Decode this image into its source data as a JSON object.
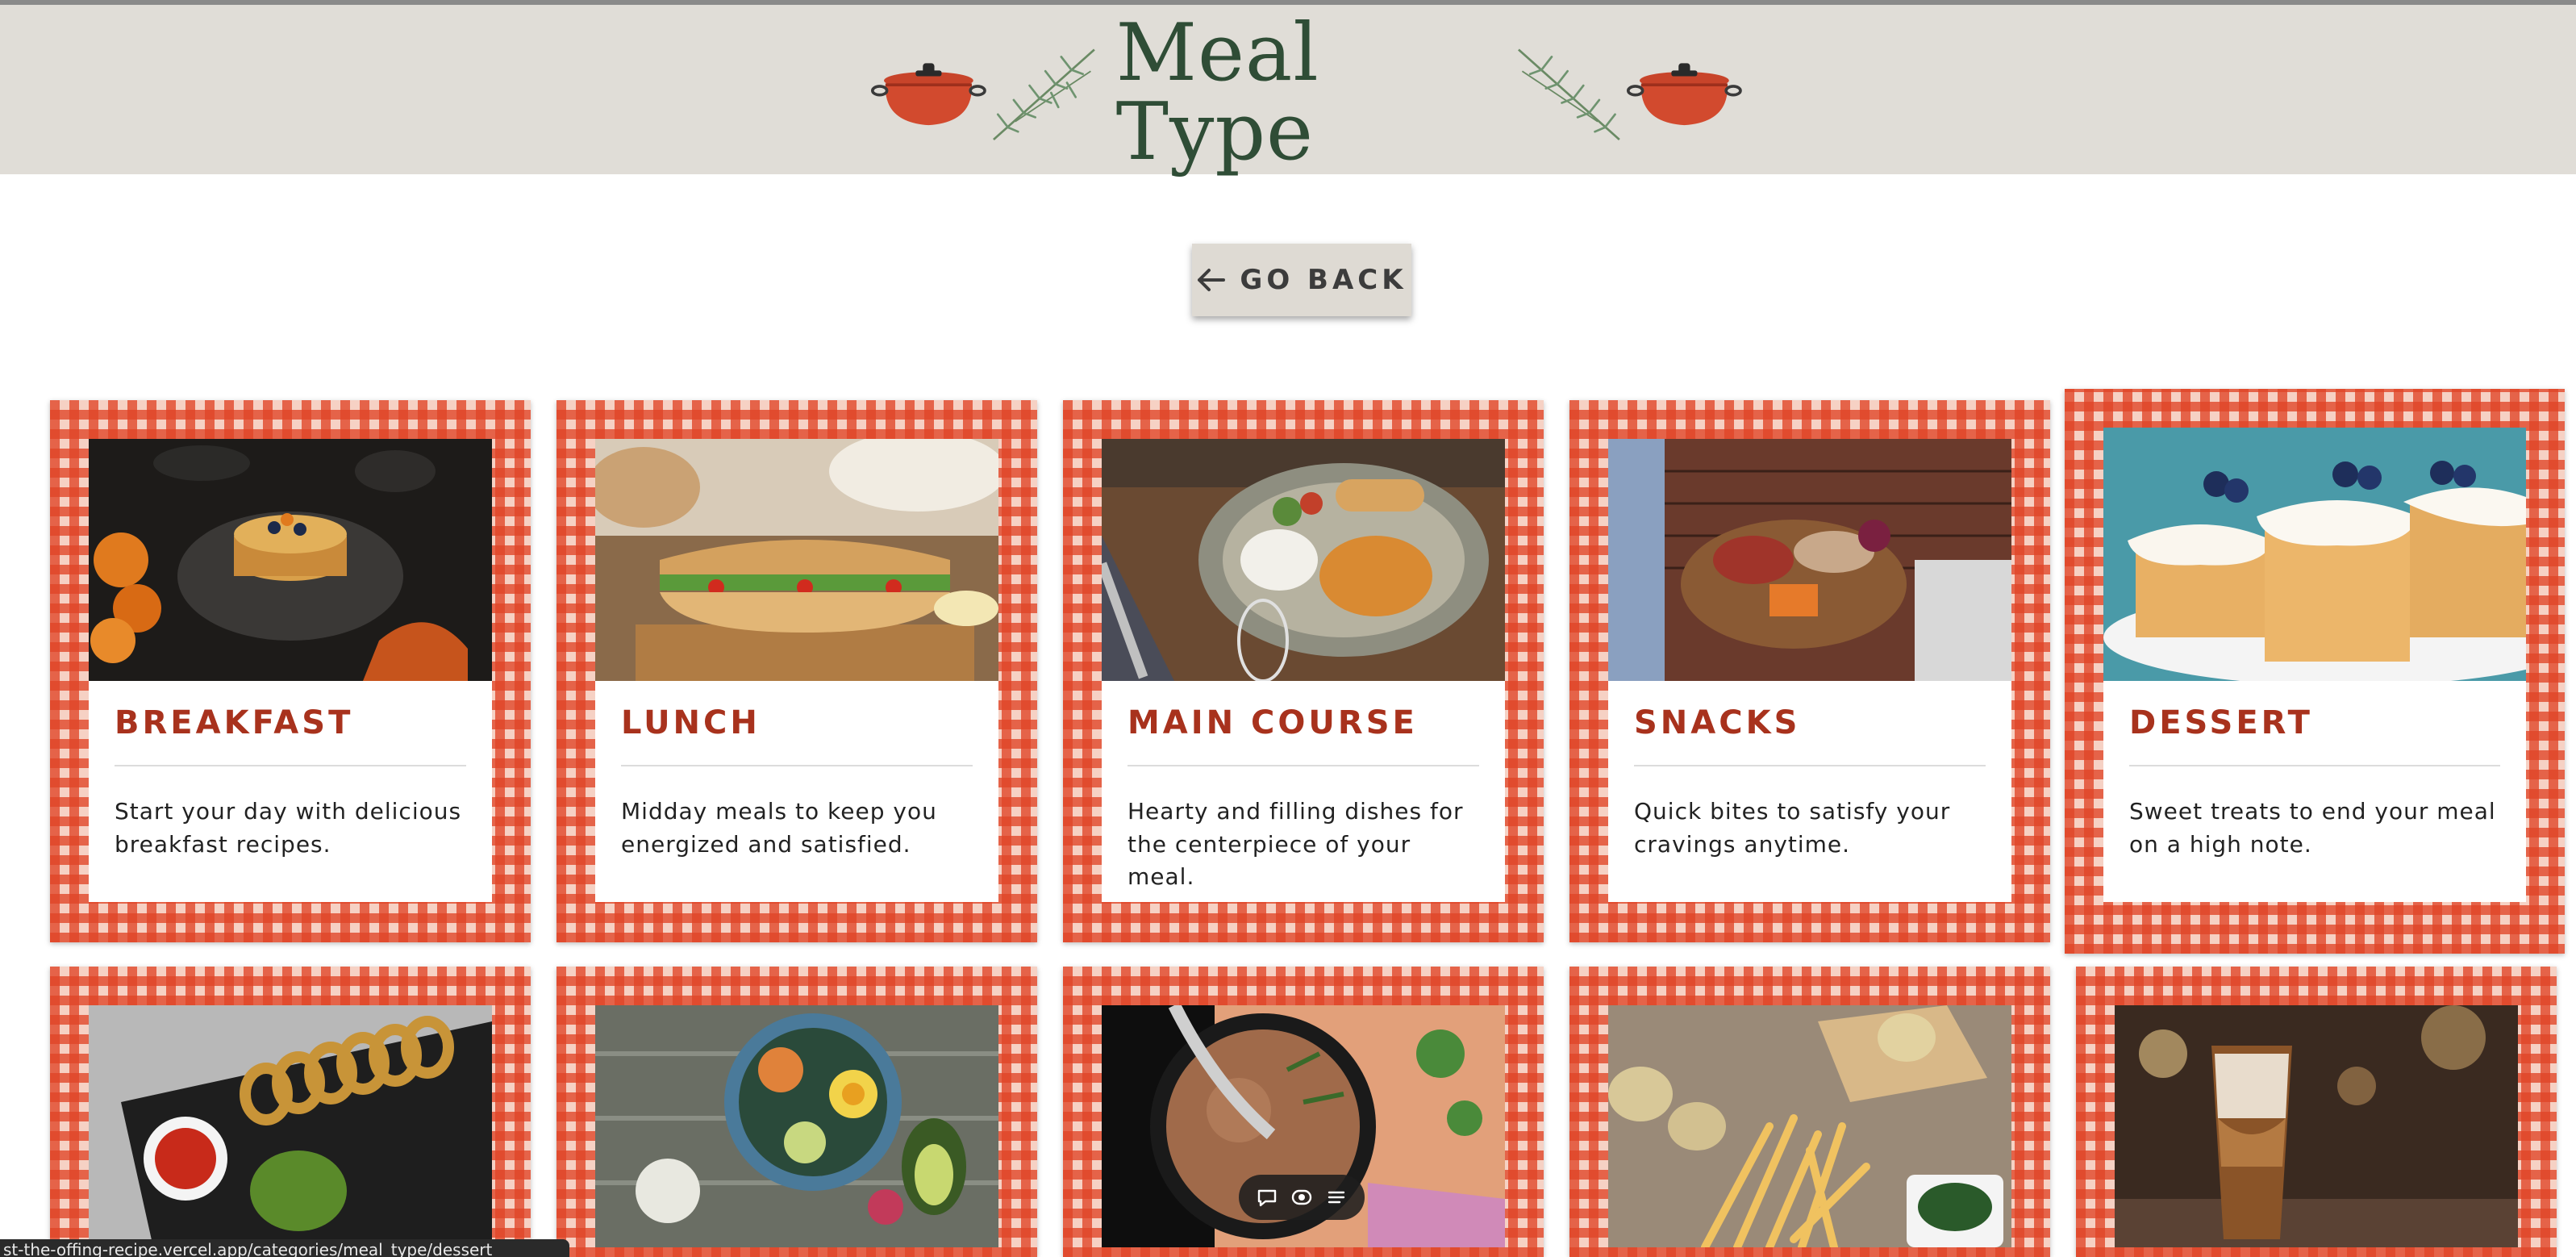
{
  "header": {
    "title": "Meal Type"
  },
  "actions": {
    "go_back_label": "GO BACK"
  },
  "cards": [
    {
      "title": "BREAKFAST",
      "description": "Start your day with delicious breakfast recipes.",
      "image": "pancakes-photo"
    },
    {
      "title": "LUNCH",
      "description": "Midday meals to keep you energized and satisfied.",
      "image": "sandwich-photo"
    },
    {
      "title": "MAIN COURSE",
      "description": "Hearty and filling dishes for the centerpiece of your meal.",
      "image": "plated-meal-photo"
    },
    {
      "title": "SNACKS",
      "description": "Quick bites to satisfy your cravings anytime.",
      "image": "charcuterie-photo"
    },
    {
      "title": "DESSERT",
      "description": "Sweet treats to end your meal on a high note.",
      "image": "blueberry-cakes-photo"
    }
  ],
  "second_row_images": [
    "onion-rings-photo",
    "salad-bowl-photo",
    "soup-pot-photo",
    "fries-photo",
    "iced-coffee-photo"
  ],
  "status_bar": {
    "url": "st-the-offing-recipe.vercel.app/categories/meal_type/dessert"
  },
  "colors": {
    "header_bg": "#e0ddd7",
    "title_green": "#2f4d36",
    "gingham_red": "#e04426",
    "card_title_red": "#a8321d"
  }
}
